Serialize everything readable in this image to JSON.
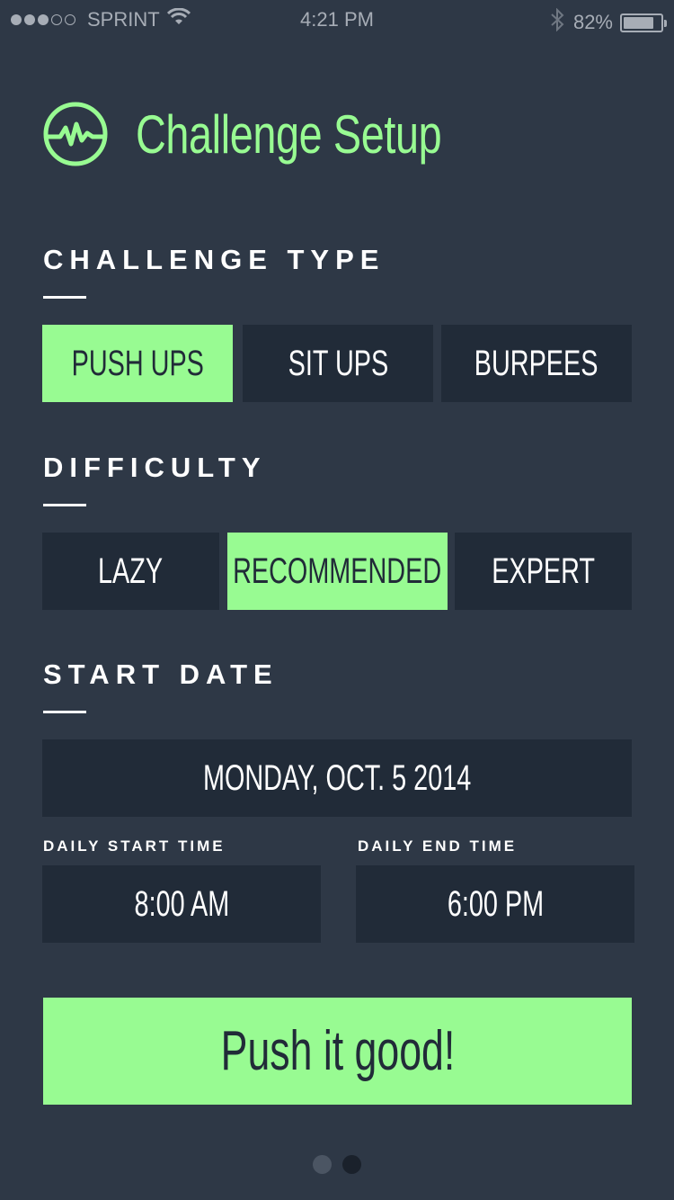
{
  "status_bar": {
    "carrier": "SPRINT",
    "time": "4:21 PM",
    "battery_percent": "82%",
    "battery_level": 0.82,
    "signal_bars_filled": 3,
    "signal_bars_total": 5
  },
  "header": {
    "title": "Challenge Setup",
    "logo_icon": "heartbeat-circle-icon"
  },
  "challenge_type": {
    "label": "CHALLENGE TYPE",
    "options": [
      {
        "label": "PUSH UPS",
        "selected": true
      },
      {
        "label": "SIT UPS",
        "selected": false
      },
      {
        "label": "BURPEES",
        "selected": false
      }
    ]
  },
  "difficulty": {
    "label": "DIFFICULTY",
    "options": [
      {
        "label": "LAZY",
        "selected": false
      },
      {
        "label": "RECOMMENDED",
        "selected": true
      },
      {
        "label": "EXPERT",
        "selected": false
      }
    ]
  },
  "start_date": {
    "label": "START DATE",
    "value": "MONDAY, OCT. 5 2014"
  },
  "daily_start_time": {
    "label": "DAILY START TIME",
    "value": "8:00 AM"
  },
  "daily_end_time": {
    "label": "DAILY END TIME",
    "value": "6:00 PM"
  },
  "cta": {
    "label": "Push it good!"
  },
  "pager": {
    "pages": 2,
    "current": 1
  },
  "colors": {
    "background": "#2e3846",
    "panel": "#212b38",
    "accent": "#98fb92",
    "text": "#ffffff"
  }
}
